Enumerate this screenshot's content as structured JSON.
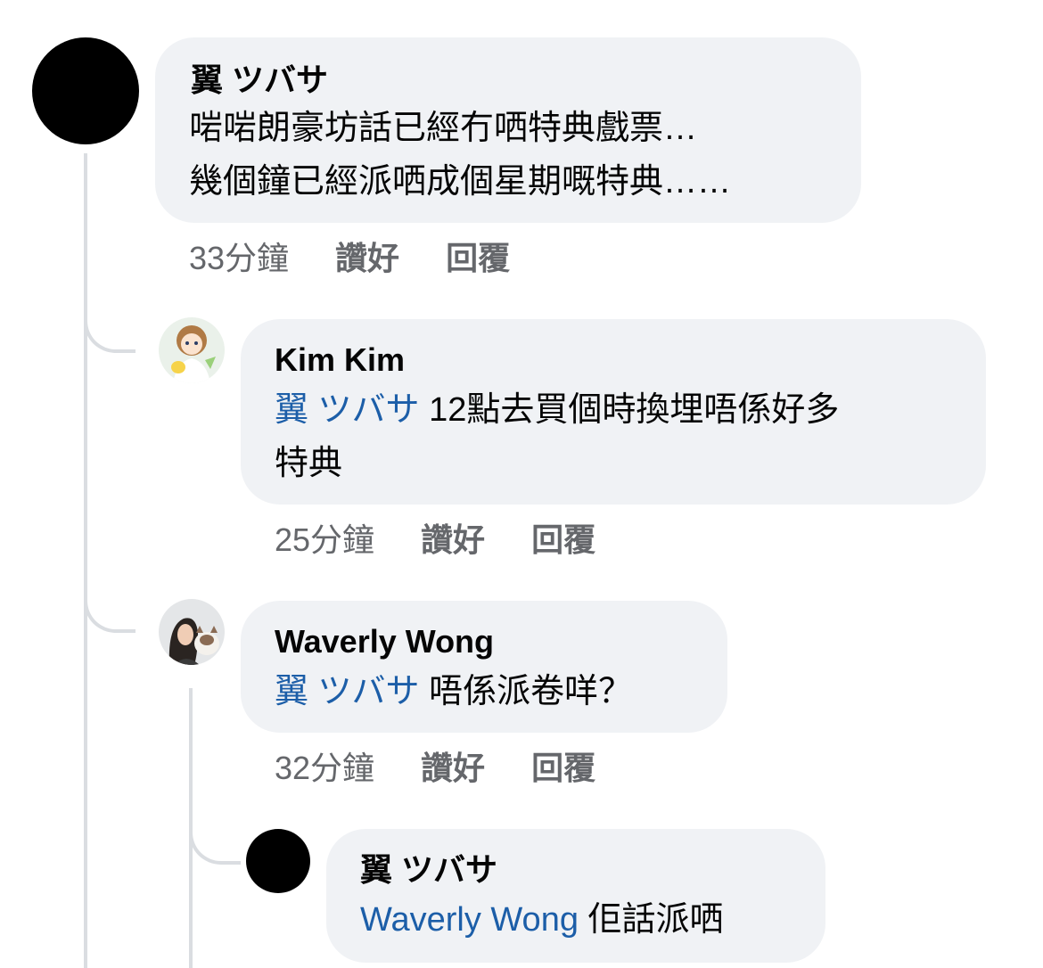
{
  "comments": [
    {
      "author": "翼 ツバサ",
      "lines": [
        "啱啱朗豪坊話已經冇哂特典戲票…",
        "幾個鐘已經派哂成個星期嘅特典……"
      ],
      "time": "33分鐘",
      "like_label": "讚好",
      "reply_label": "回覆"
    },
    {
      "author": "Kim Kim",
      "mention": "翼 ツバサ",
      "line1_rest": " 12點去買個時換埋唔係好多",
      "line2": "特典",
      "time": "25分鐘",
      "like_label": "讚好",
      "reply_label": "回覆"
    },
    {
      "author": "Waverly Wong",
      "mention": "翼 ツバサ",
      "line1_rest": " 唔係派卷咩？",
      "time": "32分鐘",
      "like_label": "讚好",
      "reply_label": "回覆"
    },
    {
      "author": "翼 ツバサ",
      "mention": "Waverly Wong",
      "line1_rest": " 佢話派哂"
    }
  ],
  "colors": {
    "bubble": "#f0f2f5",
    "mention": "#1c5ea8",
    "meta": "#65676b",
    "thread_line": "#dadde1"
  }
}
